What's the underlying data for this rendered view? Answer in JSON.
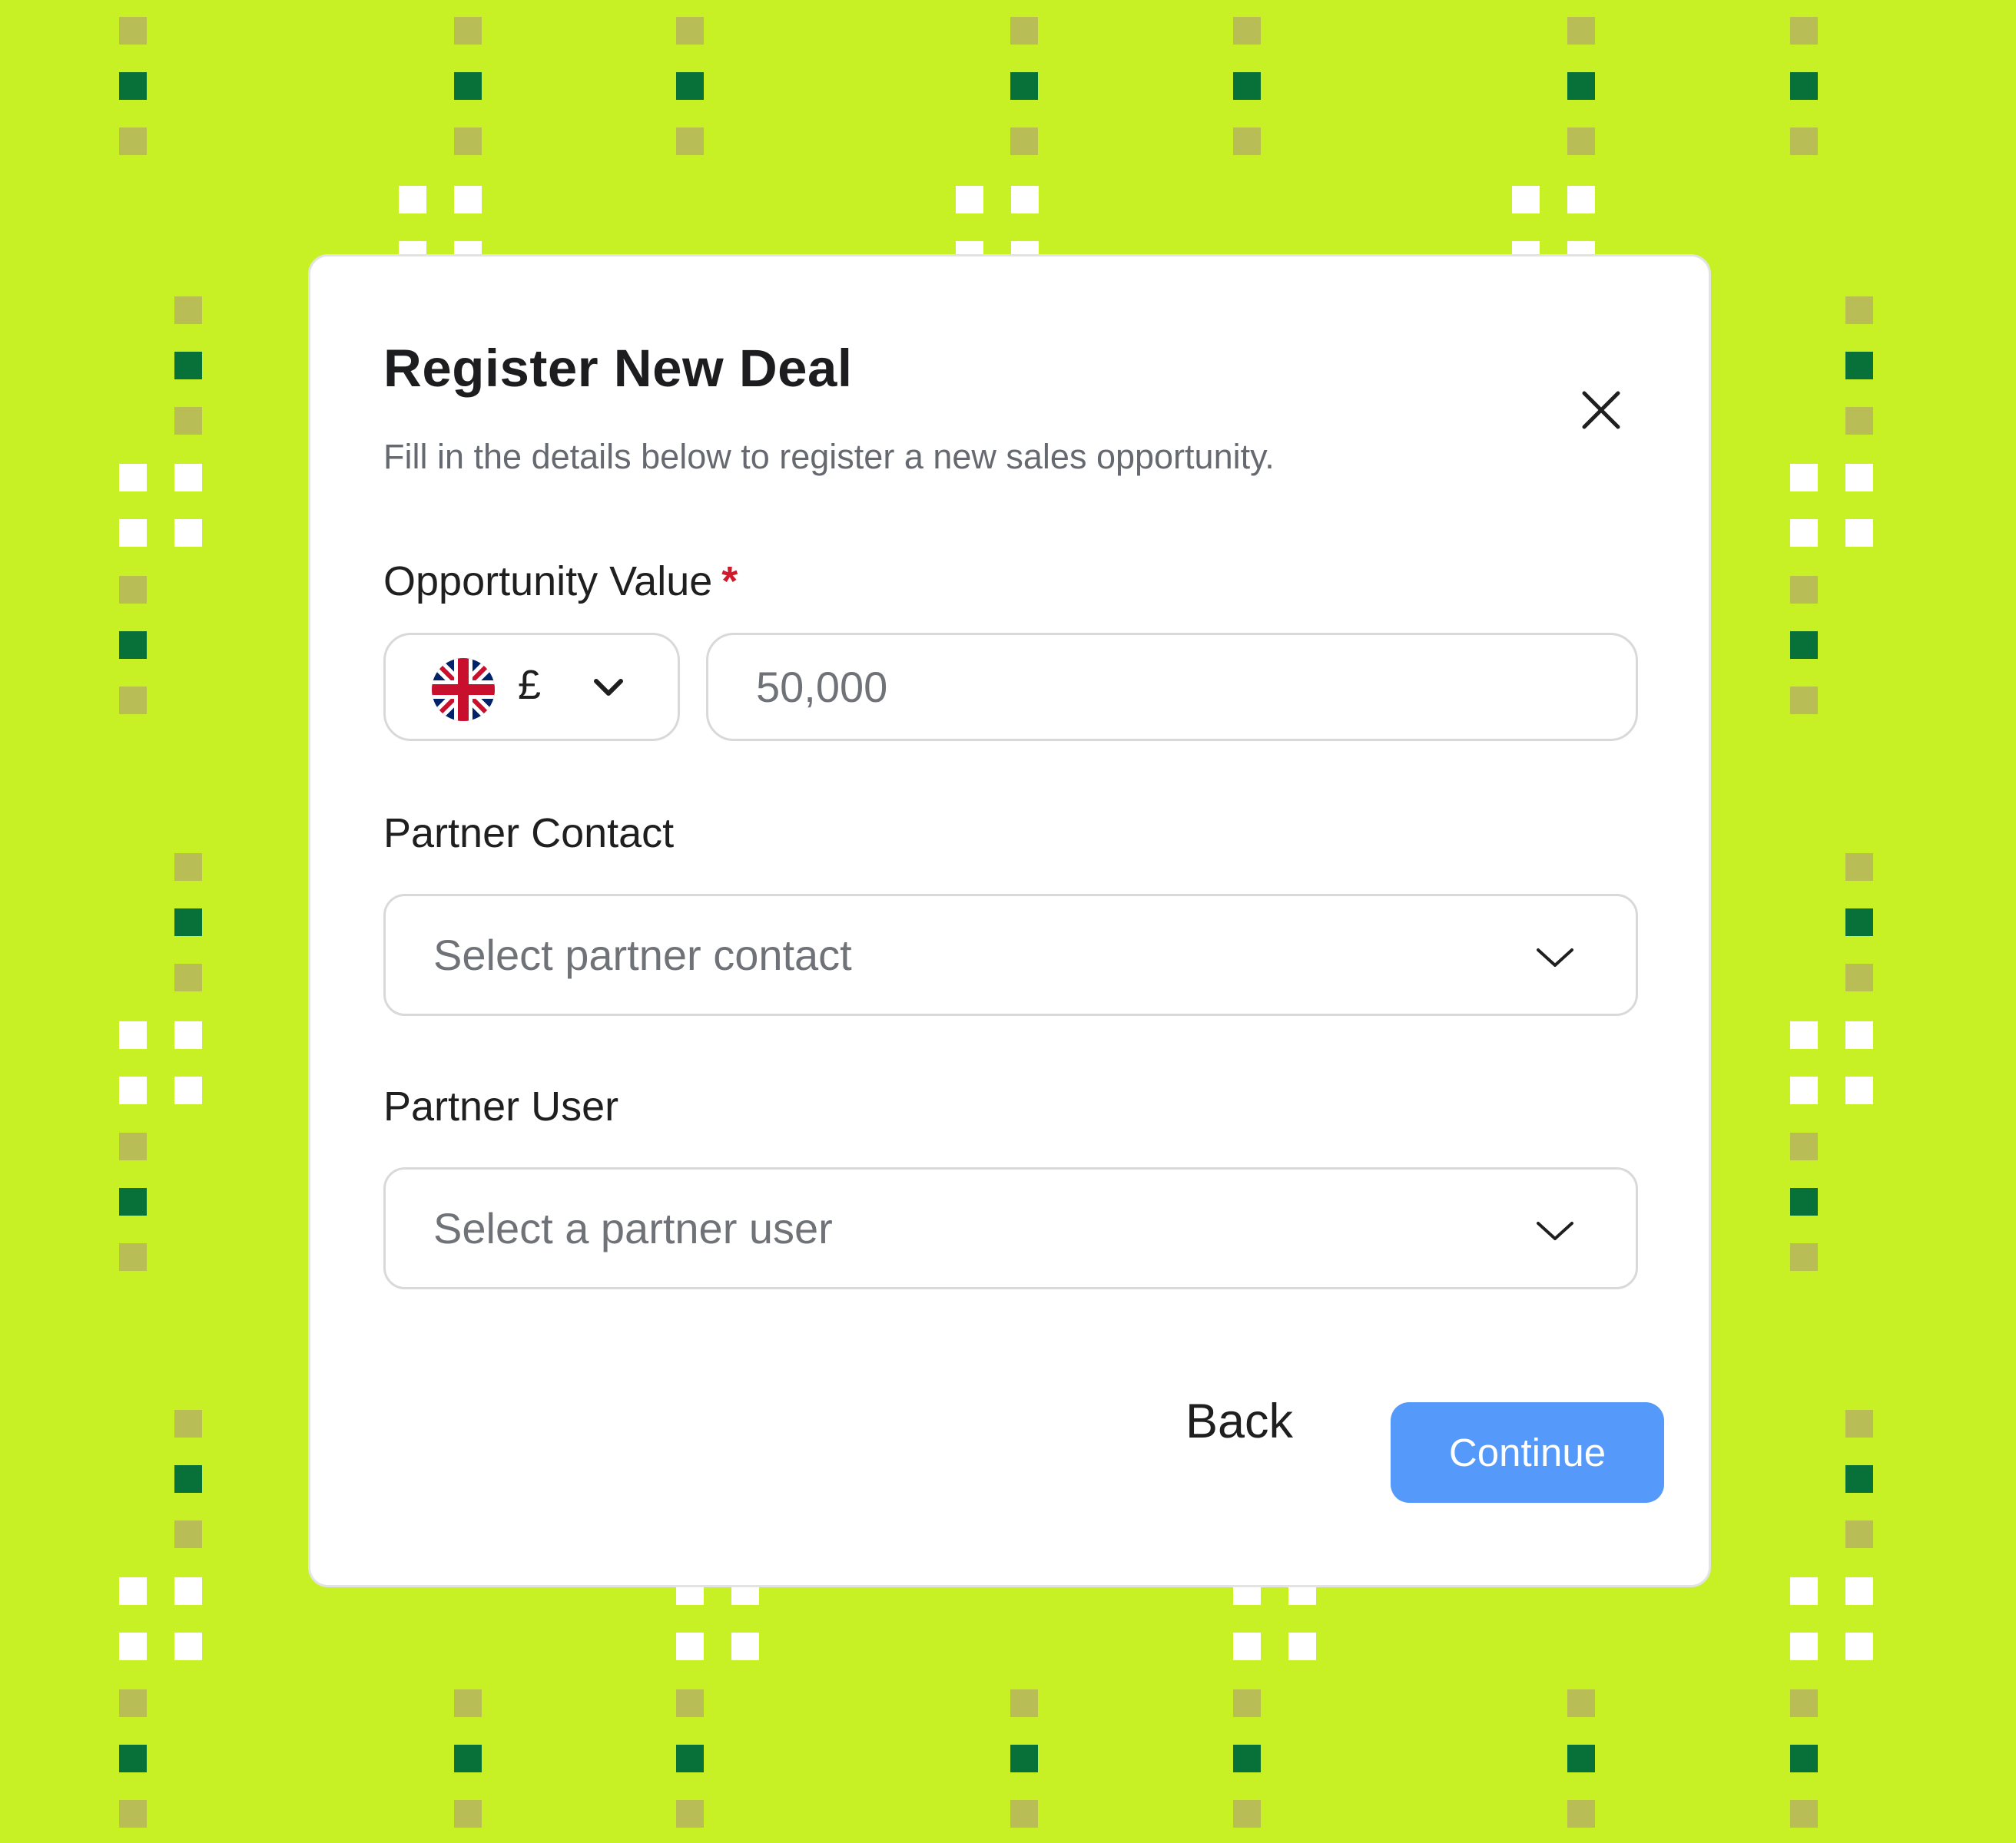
{
  "colors": {
    "background": "#c7f125",
    "square_dark_green": "#08713a",
    "square_olive": "#b9bd55",
    "square_white": "#ffffff",
    "required_marker": "#d0192b",
    "primary_button": "#5599fb"
  },
  "dialog": {
    "title": "Register New Deal",
    "subtitle": "Fill in the details below to register a new sales opportunity.",
    "close_icon": "close-icon"
  },
  "opportunity_value": {
    "label": "Opportunity Value",
    "required_marker": "*",
    "currency": {
      "flag_icon": "uk-flag-icon",
      "symbol": "£",
      "chevron_icon": "chevron-down-icon"
    },
    "amount_placeholder": "50,000"
  },
  "partner_contact": {
    "label": "Partner Contact",
    "placeholder": "Select partner contact",
    "chevron_icon": "chevron-down-icon"
  },
  "partner_user": {
    "label": "Partner User",
    "placeholder": "Select a partner user",
    "chevron_icon": "chevron-down-icon"
  },
  "footer": {
    "back_label": "Back",
    "continue_label": "Continue"
  }
}
